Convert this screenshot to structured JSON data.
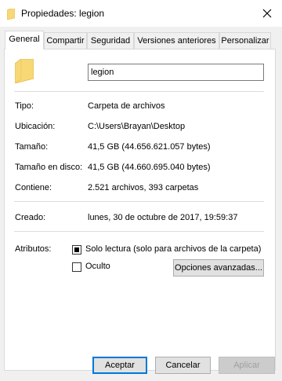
{
  "window": {
    "title": "Propiedades: legion",
    "close_icon": "close-x-icon"
  },
  "tabs": [
    {
      "label": "General",
      "active": true
    },
    {
      "label": "Compartir",
      "active": false
    },
    {
      "label": "Seguridad",
      "active": false
    },
    {
      "label": "Versiones anteriores",
      "active": false
    },
    {
      "label": "Personalizar",
      "active": false
    }
  ],
  "general": {
    "folder_icon": "folder-icon",
    "name_value": "legion",
    "properties": [
      {
        "label": "Tipo:",
        "value": "Carpeta de archivos"
      },
      {
        "label": "Ubicación:",
        "value": "C:\\Users\\Brayan\\Desktop"
      },
      {
        "label": "Tamaño:",
        "value": "41,5 GB (44.656.621.057 bytes)"
      },
      {
        "label": "Tamaño en disco:",
        "value": "41,5 GB (44.660.695.040 bytes)"
      },
      {
        "label": "Contiene:",
        "value": "2.521 archivos, 393 carpetas"
      }
    ],
    "created": {
      "label": "Creado:",
      "value": "lunes, 30 de octubre de 2017, 19:59:37"
    },
    "attributes": {
      "label": "Atributos:",
      "read_only": {
        "label": "Solo lectura (solo para archivos de la carpeta)",
        "checked": true
      },
      "hidden": {
        "label": "Oculto",
        "checked": false
      },
      "advanced_button": "Opciones avanzadas..."
    }
  },
  "buttons": {
    "ok": "Aceptar",
    "cancel": "Cancelar",
    "apply": "Aplicar"
  },
  "colors": {
    "folder_yellow": "#f8d775",
    "accent_blue": "#0078d7"
  }
}
